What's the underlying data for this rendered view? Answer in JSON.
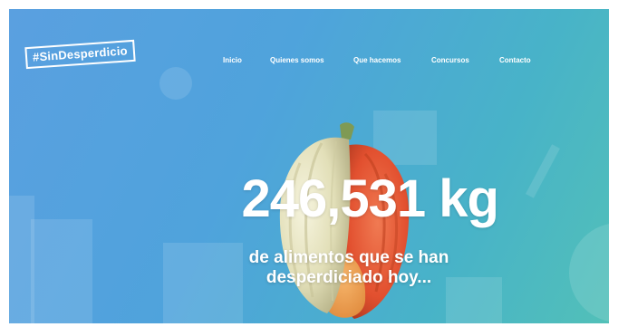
{
  "brand": {
    "logo_text": "#SinDesperdicio"
  },
  "nav": {
    "items": [
      {
        "label": "Inicio"
      },
      {
        "label": "Quienes somos"
      },
      {
        "label": "Que hacemos"
      },
      {
        "label": "Concursos"
      },
      {
        "label": "Contacto"
      }
    ]
  },
  "hero": {
    "number": "246,531 kg",
    "subtitle_line1": "de alimentos que se han",
    "subtitle_line2": "desperdiciado hoy..."
  },
  "colors": {
    "gradient_start": "#5aa0e0",
    "gradient_end": "#52c0b8",
    "text": "#ffffff",
    "tomato_red": "#e85a3a",
    "tomato_cream": "#ece9c9"
  },
  "icons": {
    "hero_image": "heirloom-tomato"
  }
}
